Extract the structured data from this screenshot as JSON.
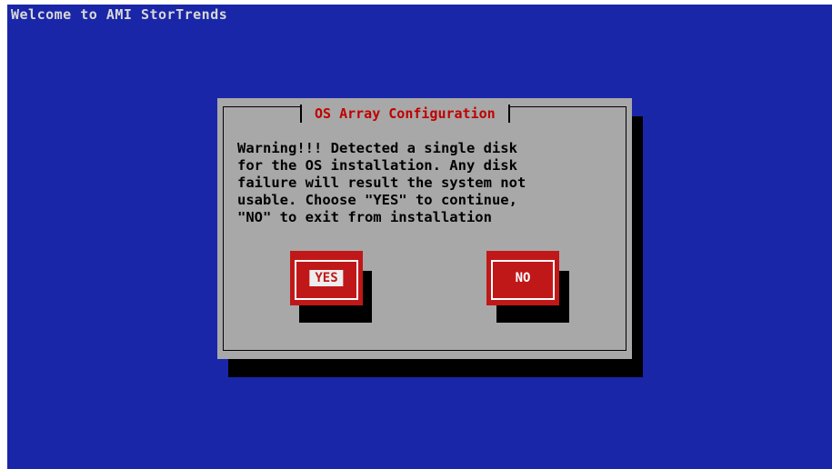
{
  "header": {
    "title": "Welcome to AMI StorTrends"
  },
  "dialog": {
    "title": "OS Array Configuration",
    "message": "Warning!!! Detected a single disk\nfor the OS installation. Any disk\nfailure will result the system not\nusable. Choose \"YES\" to continue,\n\"NO\" to exit from installation",
    "buttons": {
      "yes_label": "YES",
      "no_label": "NO"
    }
  },
  "colors": {
    "background": "#1a26a8",
    "dialog_background": "#a8a8a8",
    "title_text": "#c00000",
    "button": "#c01818"
  }
}
